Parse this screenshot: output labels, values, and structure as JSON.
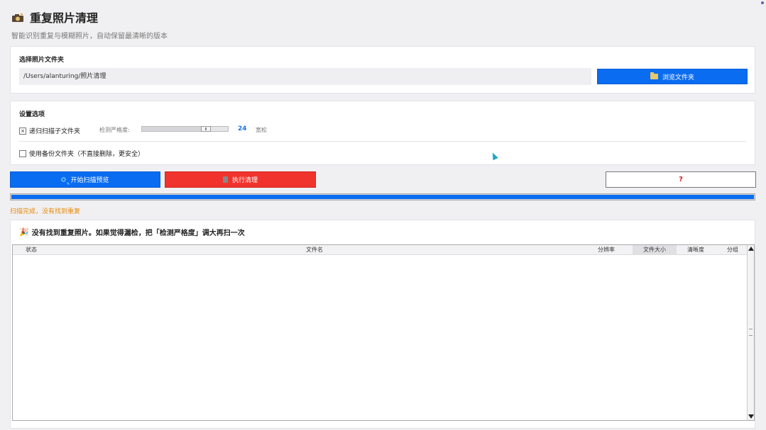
{
  "header": {
    "icon": "camera-icon",
    "title": "重复照片清理",
    "subtitle": "智能识别重复与模糊照片，自动保留最清晰的版本"
  },
  "folder": {
    "section_title": "选择照片文件夹",
    "path_value": "/Users/alanturing/照片清理",
    "browse_label": "浏览文件夹",
    "browse_icon": "folder-icon"
  },
  "options": {
    "section_title": "设置选项",
    "recursive_label": "递归扫描子文件夹",
    "recursive_checked": true,
    "sensitivity_label": "检测严格度:",
    "sensitivity_value": "24",
    "sensitivity_fraction": 0.78,
    "sensitivity_loose_label": "宽松",
    "backup_label": "使用备份文件夹（不直接删除，更安全）",
    "backup_checked": false
  },
  "actions": {
    "scan_label": "开始扫描预览",
    "scan_icon": "search-icon",
    "clean_label": "执行清理",
    "clean_icon": "trash-icon",
    "help_label": "?"
  },
  "progress": {
    "fraction": 1.0
  },
  "status": {
    "text": "扫描完成，没有找到重复",
    "color": "#e8890c"
  },
  "results": {
    "message": "没有找到重复照片。如果觉得漏检，把「检测严格度」调大再扫一次",
    "message_icon": "party-icon",
    "columns": [
      "状态",
      "文件名",
      "分辨率",
      "文件大小",
      "清晰度",
      "分组"
    ],
    "rows": []
  },
  "colors": {
    "accent": "#0a6cf0",
    "danger": "#f0332d",
    "warning": "#e8890c"
  }
}
